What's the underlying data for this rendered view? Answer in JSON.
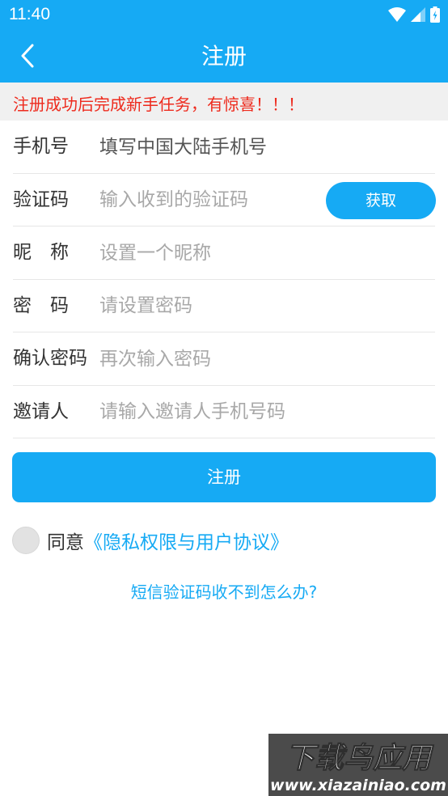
{
  "status_bar": {
    "time": "11:40"
  },
  "header": {
    "title": "注册"
  },
  "notice": {
    "text": "注册成功后完成新手任务，有惊喜！！！"
  },
  "form": {
    "phone": {
      "label": "手机号",
      "placeholder": "填写中国大陆手机号"
    },
    "code": {
      "label": "验证码",
      "placeholder": "输入收到的验证码",
      "button_label": "获取"
    },
    "nickname": {
      "label": "昵　称",
      "placeholder": "设置一个昵称"
    },
    "password": {
      "label": "密　码",
      "placeholder": "请设置密码"
    },
    "confirm": {
      "label": "确认密码",
      "placeholder": "再次输入密码"
    },
    "inviter": {
      "label": "邀请人",
      "placeholder": "请输入邀请人手机号码"
    }
  },
  "register_button": "注册",
  "agreement": {
    "prefix": "同意",
    "link": "《隐私权限与用户协议》",
    "checked": false
  },
  "sms_help": "短信验证码收不到怎么办?",
  "watermark": {
    "title": "下载鸟应用",
    "url": "www.xiazainiao.com"
  },
  "colors": {
    "primary": "#16aaf4",
    "notice_text": "#ee2b1e",
    "notice_bg": "#f0f0f0"
  },
  "icons": [
    "wifi-icon",
    "signal-icon",
    "battery-icon",
    "back-arrow-icon"
  ]
}
